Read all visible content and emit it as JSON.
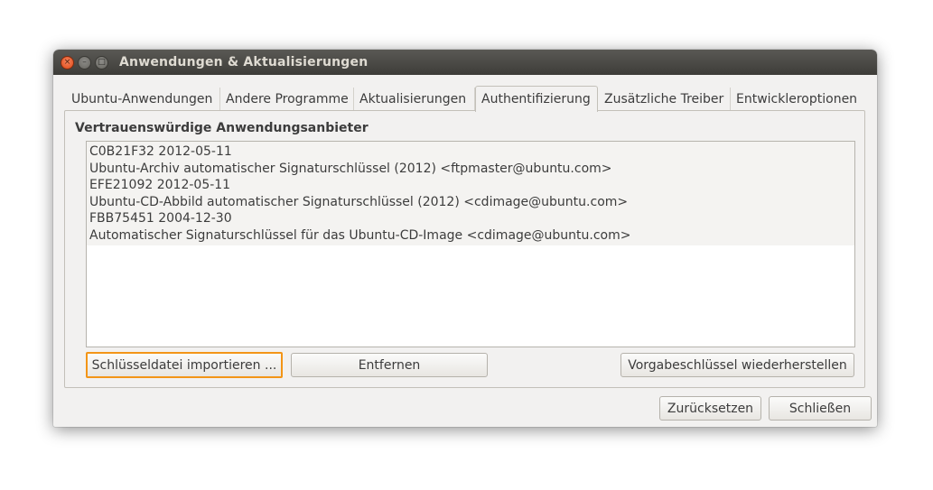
{
  "window": {
    "title": "Anwendungen & Aktualisierungen"
  },
  "title_buttons": {
    "close": "×",
    "minimize": "–",
    "maximize": "□"
  },
  "tabs": [
    {
      "label": "Ubuntu-Anwendungen"
    },
    {
      "label": "Andere Programme"
    },
    {
      "label": "Aktualisierungen"
    },
    {
      "label": "Authentifizierung"
    },
    {
      "label": "Zusätzliche Treiber"
    },
    {
      "label": "Entwickleroptionen"
    }
  ],
  "active_tab": "Authentifizierung",
  "auth": {
    "section_label": "Vertrauenswürdige Anwendungsanbieter",
    "keys": [
      {
        "id": "C0B21F32 2012-05-11",
        "desc": "Ubuntu-Archiv automatischer Signaturschlüssel (2012) <ftpmaster@ubuntu.com>"
      },
      {
        "id": "EFE21092 2012-05-11",
        "desc": "Ubuntu-CD-Abbild automatischer Signaturschlüssel (2012) <cdimage@ubuntu.com>"
      },
      {
        "id": "FBB75451 2004-12-30",
        "desc": "Automatischer Signaturschlüssel für das Ubuntu-CD-Image <cdimage@ubuntu.com>"
      }
    ],
    "import_label": "Schlüsseldatei importieren ...",
    "remove_label": "Entfernen",
    "restore_label": "Vorgabeschlüssel wiederherstellen"
  },
  "footer": {
    "reset_label": "Zurücksetzen",
    "close_label": "Schließen"
  },
  "colors": {
    "focus": "#f39517",
    "titlebar": "#3d3c38",
    "close_button": "#de4815"
  }
}
